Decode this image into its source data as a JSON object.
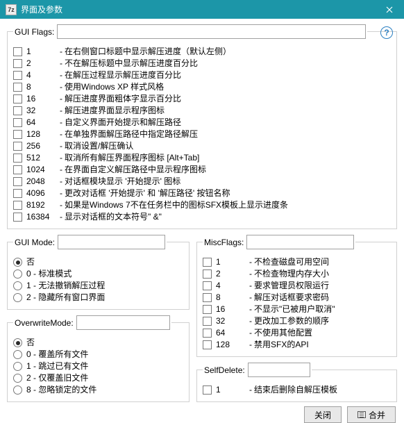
{
  "window": {
    "icon": "7z",
    "title": "界面及参数"
  },
  "guiflags": {
    "label": "GUI Flags:",
    "value": "",
    "items": [
      {
        "n": "1",
        "t": "在右侧窗口标题中显示解压进度（默认左侧）"
      },
      {
        "n": "2",
        "t": "不在解压标题中显示解压进度百分比"
      },
      {
        "n": "4",
        "t": "在解压过程显示解压进度百分比"
      },
      {
        "n": "8",
        "t": "使用Windows XP 样式风格"
      },
      {
        "n": "16",
        "t": "解压进度界面粗体字显示百分比"
      },
      {
        "n": "32",
        "t": "解压进度界面显示程序图标"
      },
      {
        "n": "64",
        "t": "自定义界面开始提示和解压路径"
      },
      {
        "n": "128",
        "t": "在单独界面解压路径中指定路径解压"
      },
      {
        "n": "256",
        "t": "取消设置/解压确认"
      },
      {
        "n": "512",
        "t": "取消所有解压界面程序图标 [Alt+Tab]"
      },
      {
        "n": "1024",
        "t": "在界面自定义解压路径中显示程序图标"
      },
      {
        "n": "2048",
        "t": "对话框模块显示 '开始提示' 图标"
      },
      {
        "n": "4096",
        "t": "更改对话框 '开始提示' 和 '解压路径' 按钮名称"
      },
      {
        "n": "8192",
        "t": "如果是Windows 7不在任务栏中的图标SFX模板上显示进度条"
      },
      {
        "n": "16384",
        "t": "显示对话框的文本符号\" &\""
      }
    ]
  },
  "guimode": {
    "label": "GUI Mode:",
    "value": "",
    "items": [
      {
        "t": "否",
        "checked": true
      },
      {
        "t": "0 - 标准模式"
      },
      {
        "t": "1 - 无法撤销解压过程"
      },
      {
        "t": "2 - 隐藏所有窗口界面"
      }
    ]
  },
  "overwrite": {
    "label": "OverwriteMode:",
    "value": "",
    "items": [
      {
        "t": "否",
        "checked": true
      },
      {
        "t": "0 - 覆盖所有文件"
      },
      {
        "t": "1 - 跳过已有文件"
      },
      {
        "t": "2 - 仅覆盖旧文件"
      },
      {
        "t": "8 - 忽略锁定的文件"
      }
    ]
  },
  "miscflags": {
    "label": "MiscFlags:",
    "value": "",
    "items": [
      {
        "n": "1",
        "t": "不检查磁盘可用空间"
      },
      {
        "n": "2",
        "t": "不检查物理内存大小"
      },
      {
        "n": "4",
        "t": "要求管理员权限运行"
      },
      {
        "n": "8",
        "t": "解压对话框要求密码"
      },
      {
        "n": "16",
        "t": "不显示\"已被用户取消\""
      },
      {
        "n": "32",
        "t": "更改加工参数的顺序"
      },
      {
        "n": "64",
        "t": "不使用其他配置"
      },
      {
        "n": "128",
        "t": "禁用SFX的API"
      }
    ]
  },
  "selfdelete": {
    "label": "SelfDelete:",
    "value": "",
    "items": [
      {
        "n": "1",
        "t": "结束后删除自解压模板"
      }
    ]
  },
  "buttons": {
    "close": "关闭",
    "merge": "合并"
  }
}
